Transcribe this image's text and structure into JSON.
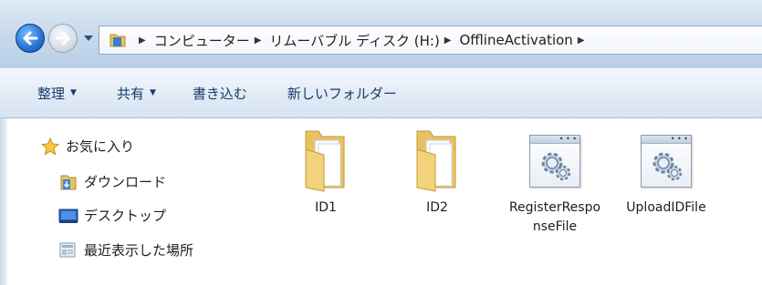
{
  "address_bar": {
    "back_icon": "back-arrow-icon",
    "forward_icon": "forward-arrow-icon",
    "breadcrumbs": [
      "コンピューター",
      "リムーバブル ディスク (H:)",
      "OfflineActivation"
    ]
  },
  "toolbar": {
    "organize_label": "整理",
    "share_label": "共有",
    "burn_label": "書き込む",
    "new_folder_label": "新しいフォルダー"
  },
  "nav_pane": {
    "items": [
      {
        "label": "お気に入り",
        "icon": "favorites-star-icon"
      },
      {
        "label": "ダウンロード",
        "icon": "downloads-folder-icon"
      },
      {
        "label": "デスクトップ",
        "icon": "desktop-icon"
      },
      {
        "label": "最近表示した場所",
        "icon": "recent-places-icon"
      }
    ]
  },
  "files": [
    {
      "name": "ID1",
      "type": "folder"
    },
    {
      "name": "ID2",
      "type": "folder"
    },
    {
      "name": "RegisterResponseFile",
      "type": "application"
    },
    {
      "name": "UploadIDFile",
      "type": "application"
    }
  ],
  "colors": {
    "address_bar_bg": "#c6d8ec",
    "command_bar_bg": "#e3ecf6",
    "command_text": "#1a3a6b",
    "folder_yellow": "#f2d27a"
  }
}
